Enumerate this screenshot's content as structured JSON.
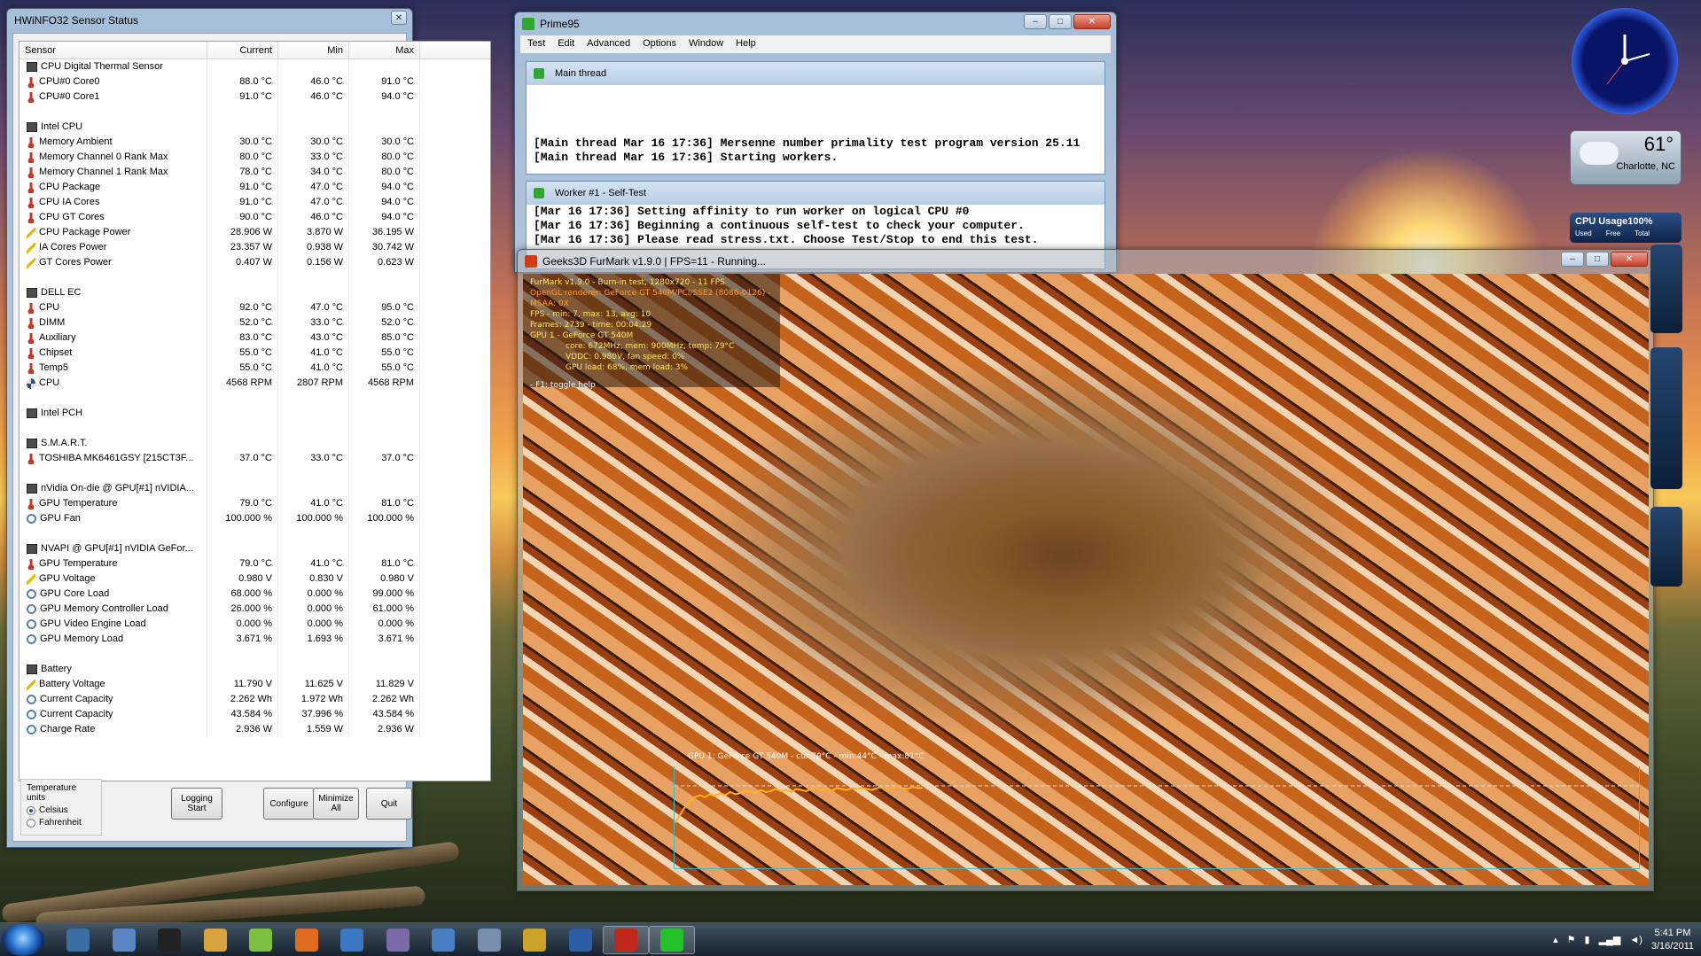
{
  "hwinfo": {
    "title": "HWiNFO32 Sensor Status",
    "columns": [
      "Sensor",
      "Current",
      "Min",
      "Max"
    ],
    "rows": [
      {
        "type": "group",
        "icon": "chip-icon",
        "label": "CPU Digital Thermal Sensor"
      },
      {
        "icon": "thermometer-icon",
        "label": "CPU#0 Core0",
        "cur": "88.0 °C",
        "min": "46.0 °C",
        "max": "91.0 °C"
      },
      {
        "icon": "thermometer-icon",
        "label": "CPU#0 Core1",
        "cur": "91.0 °C",
        "min": "46.0 °C",
        "max": "94.0 °C"
      },
      {
        "type": "blank"
      },
      {
        "type": "group",
        "icon": "chip-icon",
        "label": "Intel CPU"
      },
      {
        "icon": "thermometer-icon",
        "label": "Memory Ambient",
        "cur": "30.0 °C",
        "min": "30.0 °C",
        "max": "30.0 °C"
      },
      {
        "icon": "thermometer-icon",
        "label": "Memory Channel 0 Rank Max",
        "cur": "80.0 °C",
        "min": "33.0 °C",
        "max": "80.0 °C"
      },
      {
        "icon": "thermometer-icon",
        "label": "Memory Channel 1 Rank Max",
        "cur": "78.0 °C",
        "min": "34.0 °C",
        "max": "80.0 °C"
      },
      {
        "icon": "thermometer-icon",
        "label": "CPU Package",
        "cur": "91.0 °C",
        "min": "47.0 °C",
        "max": "94.0 °C"
      },
      {
        "icon": "thermometer-icon",
        "label": "CPU IA Cores",
        "cur": "91.0 °C",
        "min": "47.0 °C",
        "max": "94.0 °C"
      },
      {
        "icon": "thermometer-icon",
        "label": "CPU GT Cores",
        "cur": "90.0 °C",
        "min": "46.0 °C",
        "max": "94.0 °C"
      },
      {
        "icon": "power-icon",
        "label": "CPU Package Power",
        "cur": "28.906 W",
        "min": "3.870 W",
        "max": "36.195 W"
      },
      {
        "icon": "power-icon",
        "label": "IA Cores Power",
        "cur": "23.357 W",
        "min": "0.938 W",
        "max": "30.742 W"
      },
      {
        "icon": "power-icon",
        "label": "GT Cores Power",
        "cur": "0.407 W",
        "min": "0.156 W",
        "max": "0.623 W"
      },
      {
        "type": "blank"
      },
      {
        "type": "group",
        "icon": "chip-icon",
        "label": "DELL EC"
      },
      {
        "icon": "thermometer-icon",
        "label": "CPU",
        "cur": "92.0 °C",
        "min": "47.0 °C",
        "max": "95.0 °C"
      },
      {
        "icon": "thermometer-icon",
        "label": "DIMM",
        "cur": "52.0 °C",
        "min": "33.0 °C",
        "max": "52.0 °C"
      },
      {
        "icon": "thermometer-icon",
        "label": "Auxiliary",
        "cur": "83.0 °C",
        "min": "43.0 °C",
        "max": "85.0 °C"
      },
      {
        "icon": "thermometer-icon",
        "label": "Chipset",
        "cur": "55.0 °C",
        "min": "41.0 °C",
        "max": "55.0 °C"
      },
      {
        "icon": "thermometer-icon",
        "label": "Temp5",
        "cur": "55.0 °C",
        "min": "41.0 °C",
        "max": "55.0 °C"
      },
      {
        "icon": "fan-icon",
        "label": "CPU",
        "cur": "4568 RPM",
        "min": "2807 RPM",
        "max": "4568 RPM"
      },
      {
        "type": "blank"
      },
      {
        "type": "group",
        "icon": "chip-icon",
        "label": "Intel PCH"
      },
      {
        "type": "blank"
      },
      {
        "type": "group",
        "icon": "chip-icon",
        "label": "S.M.A.R.T."
      },
      {
        "icon": "thermometer-icon",
        "label": "TOSHIBA MK6461GSY [215CT3F...",
        "cur": "37.0 °C",
        "min": "33.0 °C",
        "max": "37.0 °C"
      },
      {
        "type": "blank"
      },
      {
        "type": "group",
        "icon": "chip-icon",
        "label": "nVidia On-die @ GPU[#1] nVIDIA..."
      },
      {
        "icon": "thermometer-icon",
        "label": "GPU Temperature",
        "cur": "79.0 °C",
        "min": "41.0 °C",
        "max": "81.0 °C"
      },
      {
        "icon": "gauge-icon",
        "label": "GPU Fan",
        "cur": "100.000 %",
        "min": "100.000 %",
        "max": "100.000 %"
      },
      {
        "type": "blank"
      },
      {
        "type": "group",
        "icon": "chip-icon",
        "label": "NVAPI @ GPU[#1] nVIDIA GeFor..."
      },
      {
        "icon": "thermometer-icon",
        "label": "GPU Temperature",
        "cur": "79.0 °C",
        "min": "41.0 °C",
        "max": "81.0 °C"
      },
      {
        "icon": "voltage-icon",
        "label": "GPU Voltage",
        "cur": "0.980 V",
        "min": "0.830 V",
        "max": "0.980 V"
      },
      {
        "icon": "gauge-icon",
        "label": "GPU Core Load",
        "cur": "68.000 %",
        "min": "0.000 %",
        "max": "99.000 %"
      },
      {
        "icon": "gauge-icon",
        "label": "GPU Memory Controller Load",
        "cur": "26.000 %",
        "min": "0.000 %",
        "max": "61.000 %"
      },
      {
        "icon": "gauge-icon",
        "label": "GPU Video Engine Load",
        "cur": "0.000 %",
        "min": "0.000 %",
        "max": "0.000 %"
      },
      {
        "icon": "gauge-icon",
        "label": "GPU Memory Load",
        "cur": "3.671 %",
        "min": "1.693 %",
        "max": "3.671 %"
      },
      {
        "type": "blank"
      },
      {
        "type": "group",
        "icon": "chip-icon",
        "label": "Battery"
      },
      {
        "icon": "voltage-icon",
        "label": "Battery Voltage",
        "cur": "11.790 V",
        "min": "11.625 V",
        "max": "11.829 V"
      },
      {
        "icon": "gauge-icon",
        "label": "Current Capacity",
        "cur": "2.262 Wh",
        "min": "1.972 Wh",
        "max": "2.262 Wh"
      },
      {
        "icon": "gauge-icon",
        "label": "Current Capacity",
        "cur": "43.584 %",
        "min": "37.996 %",
        "max": "43.584 %"
      },
      {
        "icon": "gauge-icon",
        "label": "Charge Rate",
        "cur": "2.936 W",
        "min": "1.559 W",
        "max": "2.936 W"
      }
    ],
    "units": {
      "label": "Temperature units",
      "celsius": "Celsius",
      "fahrenheit": "Fahrenheit",
      "selected": "Celsius"
    },
    "buttons": {
      "logging_line1": "Logging",
      "logging_line2": "Start",
      "configure": "Configure",
      "minimize_line1": "Minimize",
      "minimize_line2": "All",
      "quit": "Quit"
    }
  },
  "prime95": {
    "title": "Prime95",
    "menu": [
      "Test",
      "Edit",
      "Advanced",
      "Options",
      "Window",
      "Help"
    ],
    "main_thread": {
      "title": "Main thread",
      "lines": [
        "[Main thread Mar 16 17:36] Mersenne number primality test program version 25.11",
        "[Main thread Mar 16 17:36] Starting workers."
      ]
    },
    "worker": {
      "title": "Worker #1 - Self-Test",
      "lines": [
        "[Mar 16 17:36] Setting affinity to run worker on logical CPU #0",
        "[Mar 16 17:36] Beginning a continuous self-test to check your computer.",
        "[Mar 16 17:36] Please read stress.txt.  Choose Test/Stop to end this test."
      ]
    }
  },
  "furmark": {
    "title": "Geeks3D FurMark v1.9.0 | FPS=11 - Running...",
    "osd": [
      "FurMark v1.9.0 - Burn-in test, 1280x720 - 11 FPS",
      "OpenGL renderer: GeForce GT 540M/PCI/SSE2 (8086-0126) - MSAA: 0X",
      "FPS - min: 7, max: 13, avg: 10",
      "Frames: 2739 - time: 00:04:29",
      "GPU 1 - GeForce GT 540M",
      "core: 672MHz, mem: 900MHz, temp: 79°C",
      "VDDC: 0.980V, fan speed: 0%",
      "GPU load: 68%, mem load: 3%",
      "- F1: toggle help"
    ],
    "graph_label": "GPU 1: GeForce GT 540M - cur:79°C - min:44°C - max:81°C",
    "graph_values": [
      45,
      52,
      60,
      66,
      70,
      72,
      70,
      73,
      71,
      74,
      72,
      75,
      73,
      74,
      76,
      75,
      74,
      77,
      75,
      76,
      78,
      76,
      77,
      75,
      78,
      77,
      76,
      78,
      79,
      77,
      78,
      76,
      79,
      78,
      77,
      79,
      78,
      79,
      78,
      77,
      79,
      80,
      78,
      79,
      81,
      79,
      78,
      80,
      79,
      79
    ]
  },
  "gadgets": {
    "weather_temp": "61°",
    "weather_city": "Charlotte, NC",
    "cpu_usage_title": "CPU Usage",
    "cpu_usage_value": "100%",
    "cpu_usage_cols": [
      "Used",
      "Free",
      "Total"
    ]
  },
  "taskbar": {
    "time": "5:41 PM",
    "date": "3/16/2011",
    "colors": [
      "#3a6ea5",
      "#5a86c5",
      "#222222",
      "#d8a23c",
      "#7fbf3f",
      "#e06b1e",
      "#3a79c2",
      "#7a6aa8",
      "#4a7fc2",
      "#7a8fb0",
      "#c9a227",
      "#2c5ea8",
      "#c0281a",
      "#22c32a"
    ]
  }
}
